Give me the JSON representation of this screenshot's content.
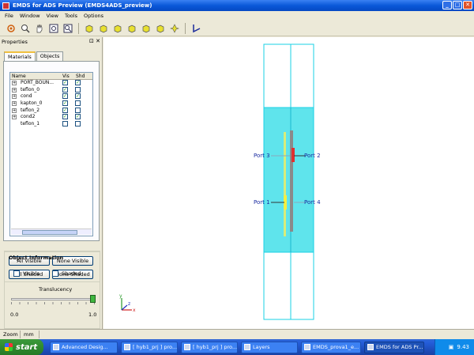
{
  "window": {
    "title": "EMDS for ADS Preview (EMDS4ADS_preview)",
    "min_label": "_",
    "max_label": "□",
    "close_label": "✕"
  },
  "menu": [
    "File",
    "Window",
    "View",
    "Tools",
    "Options"
  ],
  "toolbar": {
    "icons": [
      "orbit-icon",
      "zoom-icon",
      "pan-icon",
      "zoom-fit-icon",
      "zoom-box-icon",
      "view-front-icon",
      "view-back-icon",
      "view-left-icon",
      "view-right-icon",
      "view-top-icon",
      "view-bottom-icon",
      "view-iso-icon",
      "axes-icon"
    ]
  },
  "properties": {
    "title": "Properties",
    "pin_label": "⊡",
    "close_label": "✕",
    "tabs": [
      "Materials",
      "Objects"
    ],
    "table": {
      "headers": [
        "Name",
        "Vis",
        "Shd"
      ],
      "rows": [
        {
          "name": "PORT_BOUN...",
          "vis": true,
          "shd": true,
          "expandable": true
        },
        {
          "name": "teflon_0",
          "vis": true,
          "shd": false,
          "expandable": true
        },
        {
          "name": "cond",
          "vis": true,
          "shd": true,
          "expandable": true
        },
        {
          "name": "kapton_0",
          "vis": true,
          "shd": false,
          "expandable": true
        },
        {
          "name": "teflon_2",
          "vis": true,
          "shd": false,
          "expandable": true
        },
        {
          "name": "cond2",
          "vis": true,
          "shd": true,
          "expandable": true
        },
        {
          "name": "teflon_1",
          "vis": false,
          "shd": false,
          "expandable": false
        }
      ]
    },
    "buttons": {
      "all_visible": "All Visible",
      "none_visible": "None Visible",
      "all_shaded": "All Shaded",
      "none_shaded": "None Shaded"
    },
    "object_info": {
      "title": "Object Information",
      "visible_label": "Visible",
      "shaded_label": "Shaded",
      "translucency_label": "Translucency",
      "translucency_min": "0.0",
      "translucency_max": "1.0",
      "translucency_value": 1.0
    }
  },
  "viewport": {
    "ports": [
      "Port 3",
      "Port 2",
      "Port 1",
      "Port 4"
    ],
    "axes": [
      "x",
      "y",
      "z"
    ],
    "colors": {
      "substrate": "#5fe4ec",
      "outline": "#1ad0e6",
      "port_marker_red": "#e03030",
      "port_marker_yellow": "#f4f040",
      "conductor": "#8a8a8a"
    }
  },
  "status": {
    "mode": "Zoom",
    "units": "mm"
  },
  "taskbar": {
    "start_label": "start",
    "tasks": [
      {
        "label": "Advanced Desig...",
        "active": false
      },
      {
        "label": "[ hyb1_prj ] pro...",
        "active": false
      },
      {
        "label": "[ hyb1_prj ] pro...",
        "active": false
      },
      {
        "label": "Layers",
        "active": false
      },
      {
        "label": "EMDS_prova1_e...",
        "active": false
      },
      {
        "label": "EMDS for ADS Pr...",
        "active": true
      }
    ],
    "clock": "9.43"
  }
}
